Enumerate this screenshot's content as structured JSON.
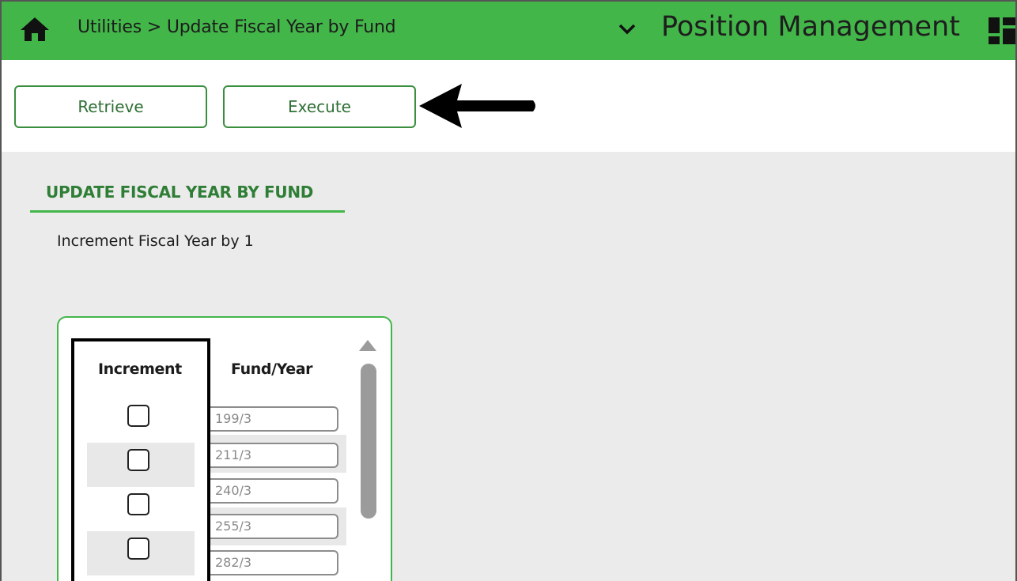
{
  "header": {
    "breadcrumb": "Utilities > Update Fiscal Year by Fund",
    "app_title": "Position Management",
    "icons": [
      "home-icon",
      "chevron-down-icon",
      "dashboard-grid-icon"
    ],
    "color": "#43b649"
  },
  "toolbar": {
    "retrieve_label": "Retrieve",
    "execute_label": "Execute",
    "annotation": "arrow-pointing-left-icon"
  },
  "section": {
    "title": "UPDATE FISCAL YEAR BY FUND",
    "description": "Increment Fiscal Year by 1"
  },
  "table": {
    "headers": [
      "Increment",
      "Fund/Year"
    ],
    "rows": [
      {
        "increment": false,
        "fund_year": "199/3"
      },
      {
        "increment": false,
        "fund_year": "211/3"
      },
      {
        "increment": false,
        "fund_year": "240/3"
      },
      {
        "increment": false,
        "fund_year": "255/3"
      },
      {
        "increment": false,
        "fund_year": "282/3"
      }
    ]
  },
  "colors": {
    "accent": "#43b649",
    "title_green": "#2f7e36",
    "button_border": "#3a8f3f",
    "background": "#ebebeb"
  }
}
